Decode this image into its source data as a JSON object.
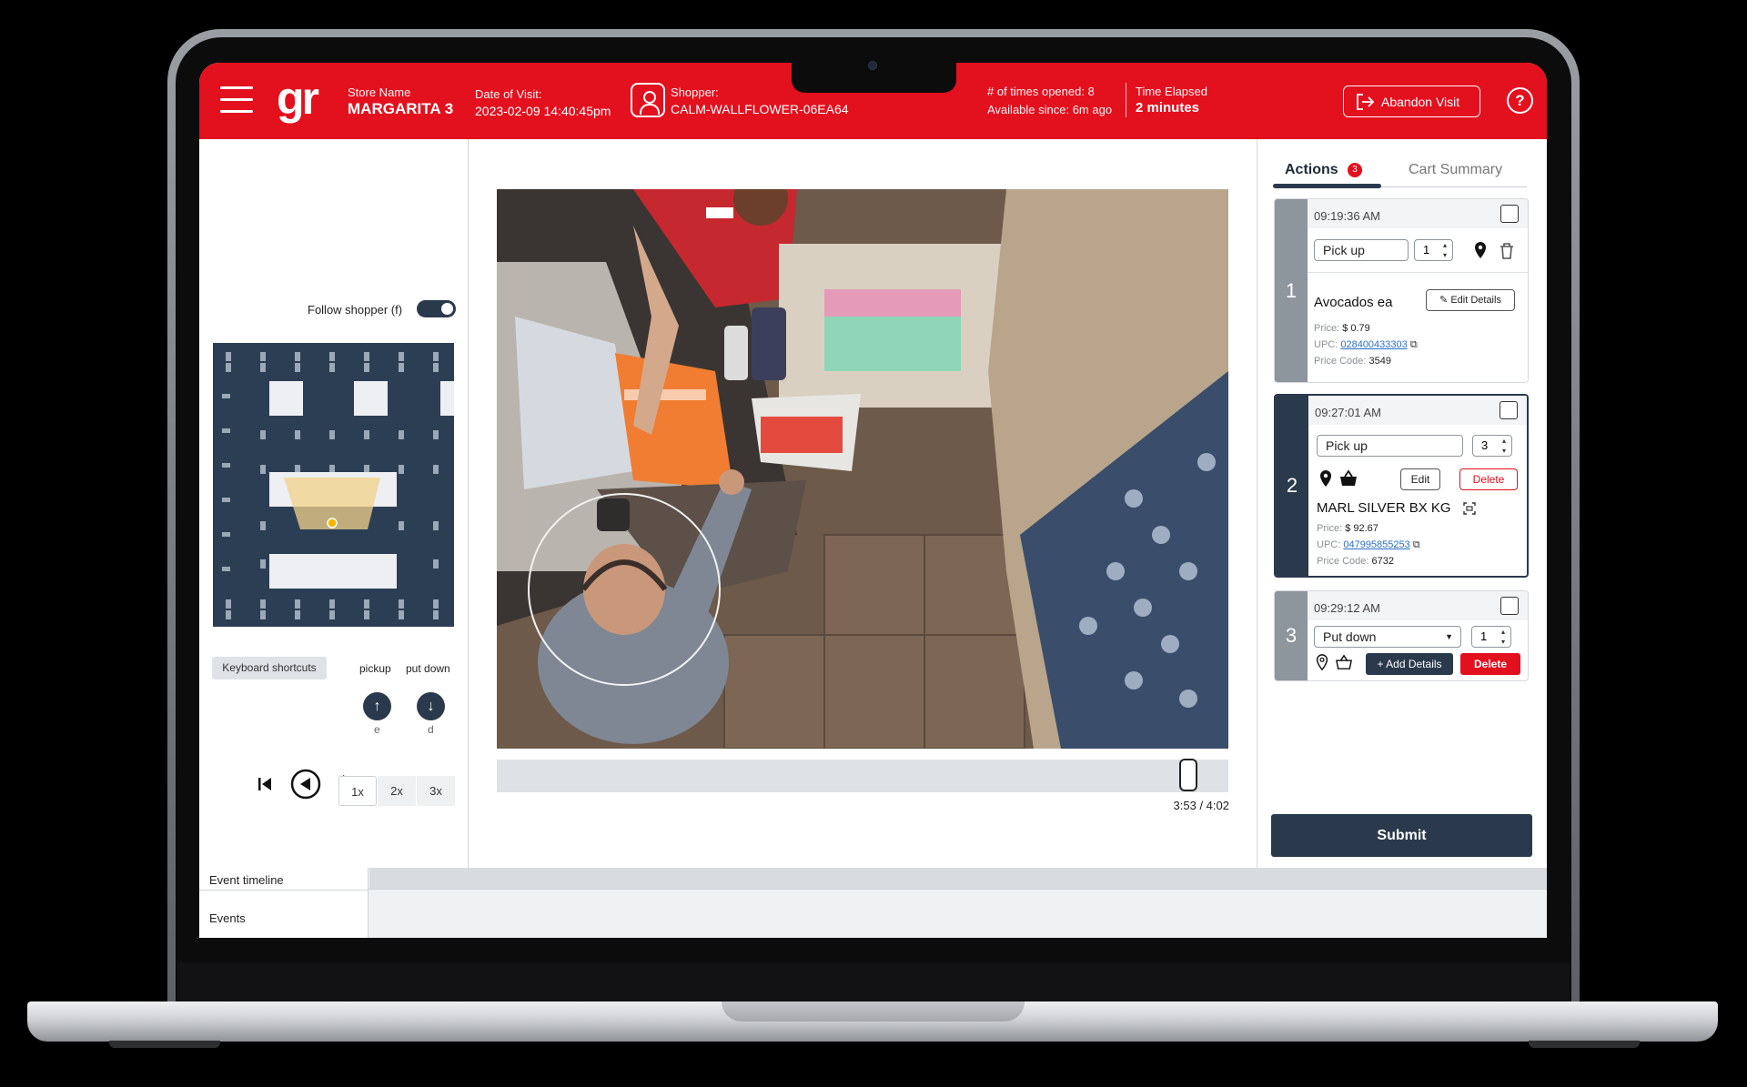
{
  "header": {
    "logo": "gr",
    "store_label": "Store Name",
    "store_value": "MARGARITA 3",
    "visit_label": "Date of Visit:",
    "visit_value": "2023-02-09 14:40:45pm",
    "shopper_label": "Shopper:",
    "shopper_value": "CALM-WALLFLOWER-06EA64",
    "opened_text": "# of times opened: 8",
    "available_text": "Available since: 6m ago",
    "elapsed_label": "Time Elapsed",
    "elapsed_value": "2 minutes",
    "abandon_label": "Abandon Visit",
    "help_label": "?"
  },
  "left": {
    "follow_label": "Follow shopper (f)",
    "follow_on": true,
    "keyboard_label": "Keyboard shortcuts",
    "shortcuts": [
      {
        "label": "pickup",
        "key": "e",
        "icon": "arrow-up-icon"
      },
      {
        "label": "put down",
        "key": "d",
        "icon": "arrow-down-icon"
      }
    ],
    "speeds": [
      "1x",
      "2x",
      "3x"
    ],
    "active_speed": "1x"
  },
  "video": {
    "progress": 0.957,
    "timecode": "3:53 / 4:02"
  },
  "tabs": {
    "actions_label": "Actions",
    "actions_badge": "3",
    "cart_label": "Cart Summary"
  },
  "actions": [
    {
      "num": "1",
      "time": "09:19:36 AM",
      "action": "Pick up",
      "qty": "1",
      "product": "Avocados ea",
      "edit_details": "Edit Details",
      "price_label": "Price:",
      "price": "$ 0.79",
      "upc_label": "UPC:",
      "upc": "028400433303",
      "code_label": "Price Code:",
      "code": "3549"
    },
    {
      "num": "2",
      "time": "09:27:01 AM",
      "action": "Pick up",
      "qty": "3",
      "edit": "Edit",
      "delete": "Delete",
      "product": "MARL SILVER BX KG",
      "price_label": "Price:",
      "price": "$ 92.67",
      "upc_label": "UPC:",
      "upc": "047995855253",
      "code_label": "Price Code:",
      "code": "6732"
    },
    {
      "num": "3",
      "time": "09:29:12 AM",
      "action": "Put down",
      "qty": "1",
      "add_details": "Add Details",
      "delete": "Delete"
    }
  ],
  "submit_label": "Submit",
  "timeline": {
    "event_timeline_label": "Event timeline",
    "events_label": "Events"
  },
  "colors": {
    "brand_red": "#e3101e",
    "navy": "#2a3a4c"
  }
}
